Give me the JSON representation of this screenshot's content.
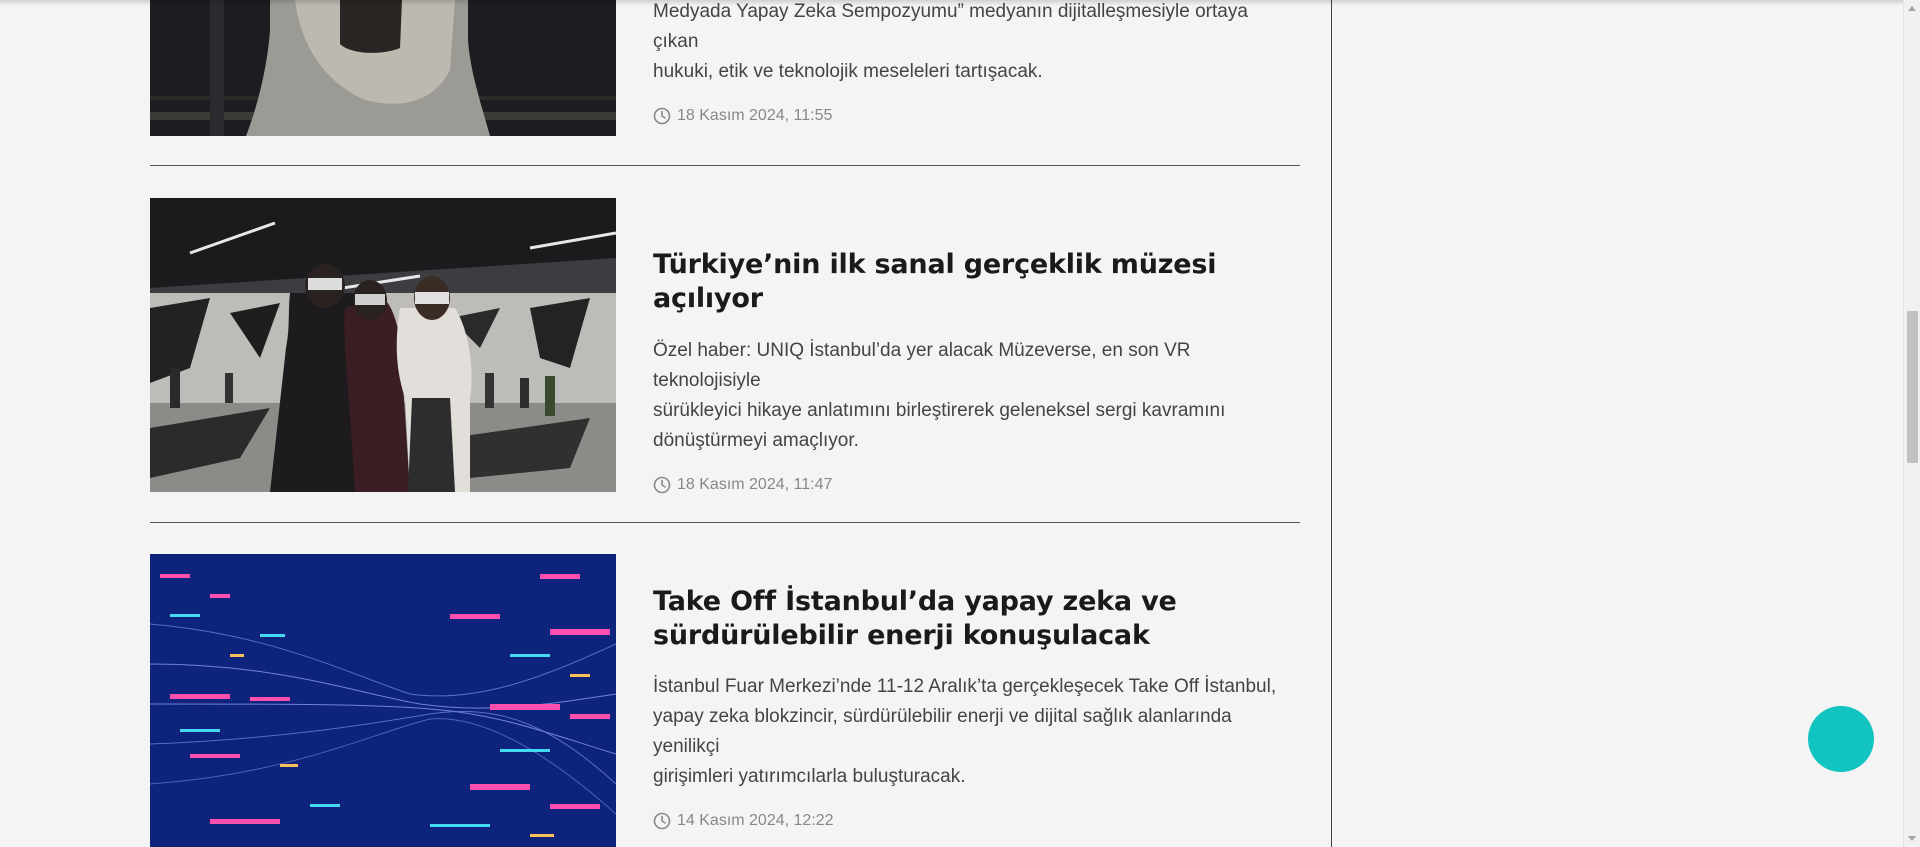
{
  "articles": [
    {
      "excerpt_lines": [
        "Medyada Yapay Zeka Sempozyumu” medyanın dijitalleşmesiyle ortaya çıkan",
        "hukuki, etik ve teknolojik meseleleri tartışacak."
      ],
      "date": "18 Kasım 2024,  11:55"
    },
    {
      "headline_lines": [
        "Türkiye’nin ilk sanal gerçeklik müzesi açılıyor"
      ],
      "excerpt_lines": [
        "Özel haber: UNIQ İstanbul’da yer alacak Müzeverse, en son VR teknolojisiyle",
        "sürükleyici hikaye anlatımını birleştirerek geleneksel sergi kavramını",
        "dönüştürmeyi amaçlıyor."
      ],
      "date": "18 Kasım 2024,  11:47"
    },
    {
      "headline_lines": [
        "Take Off İstanbul’da yapay zeka ve",
        "sürdürülebilir enerji konuşulacak"
      ],
      "excerpt_lines": [
        "İstanbul Fuar Merkezi’nde 11-12 Aralık’ta gerçekleşecek Take Off İstanbul,",
        "yapay zeka blokzincir, sürdürülebilir enerji ve dijital sağlık alanlarında yenilikçi",
        "girişimleri yatırımcılarla buluşturacak."
      ],
      "date": "14 Kasım 2024,  12:22"
    }
  ],
  "icons": {
    "clock": "clock-icon",
    "fab": "floating-action-button"
  },
  "colors": {
    "accent": "#11c4bf",
    "background": "#f4f4f4",
    "headline": "#1a1a1a",
    "meta": "#888888"
  }
}
